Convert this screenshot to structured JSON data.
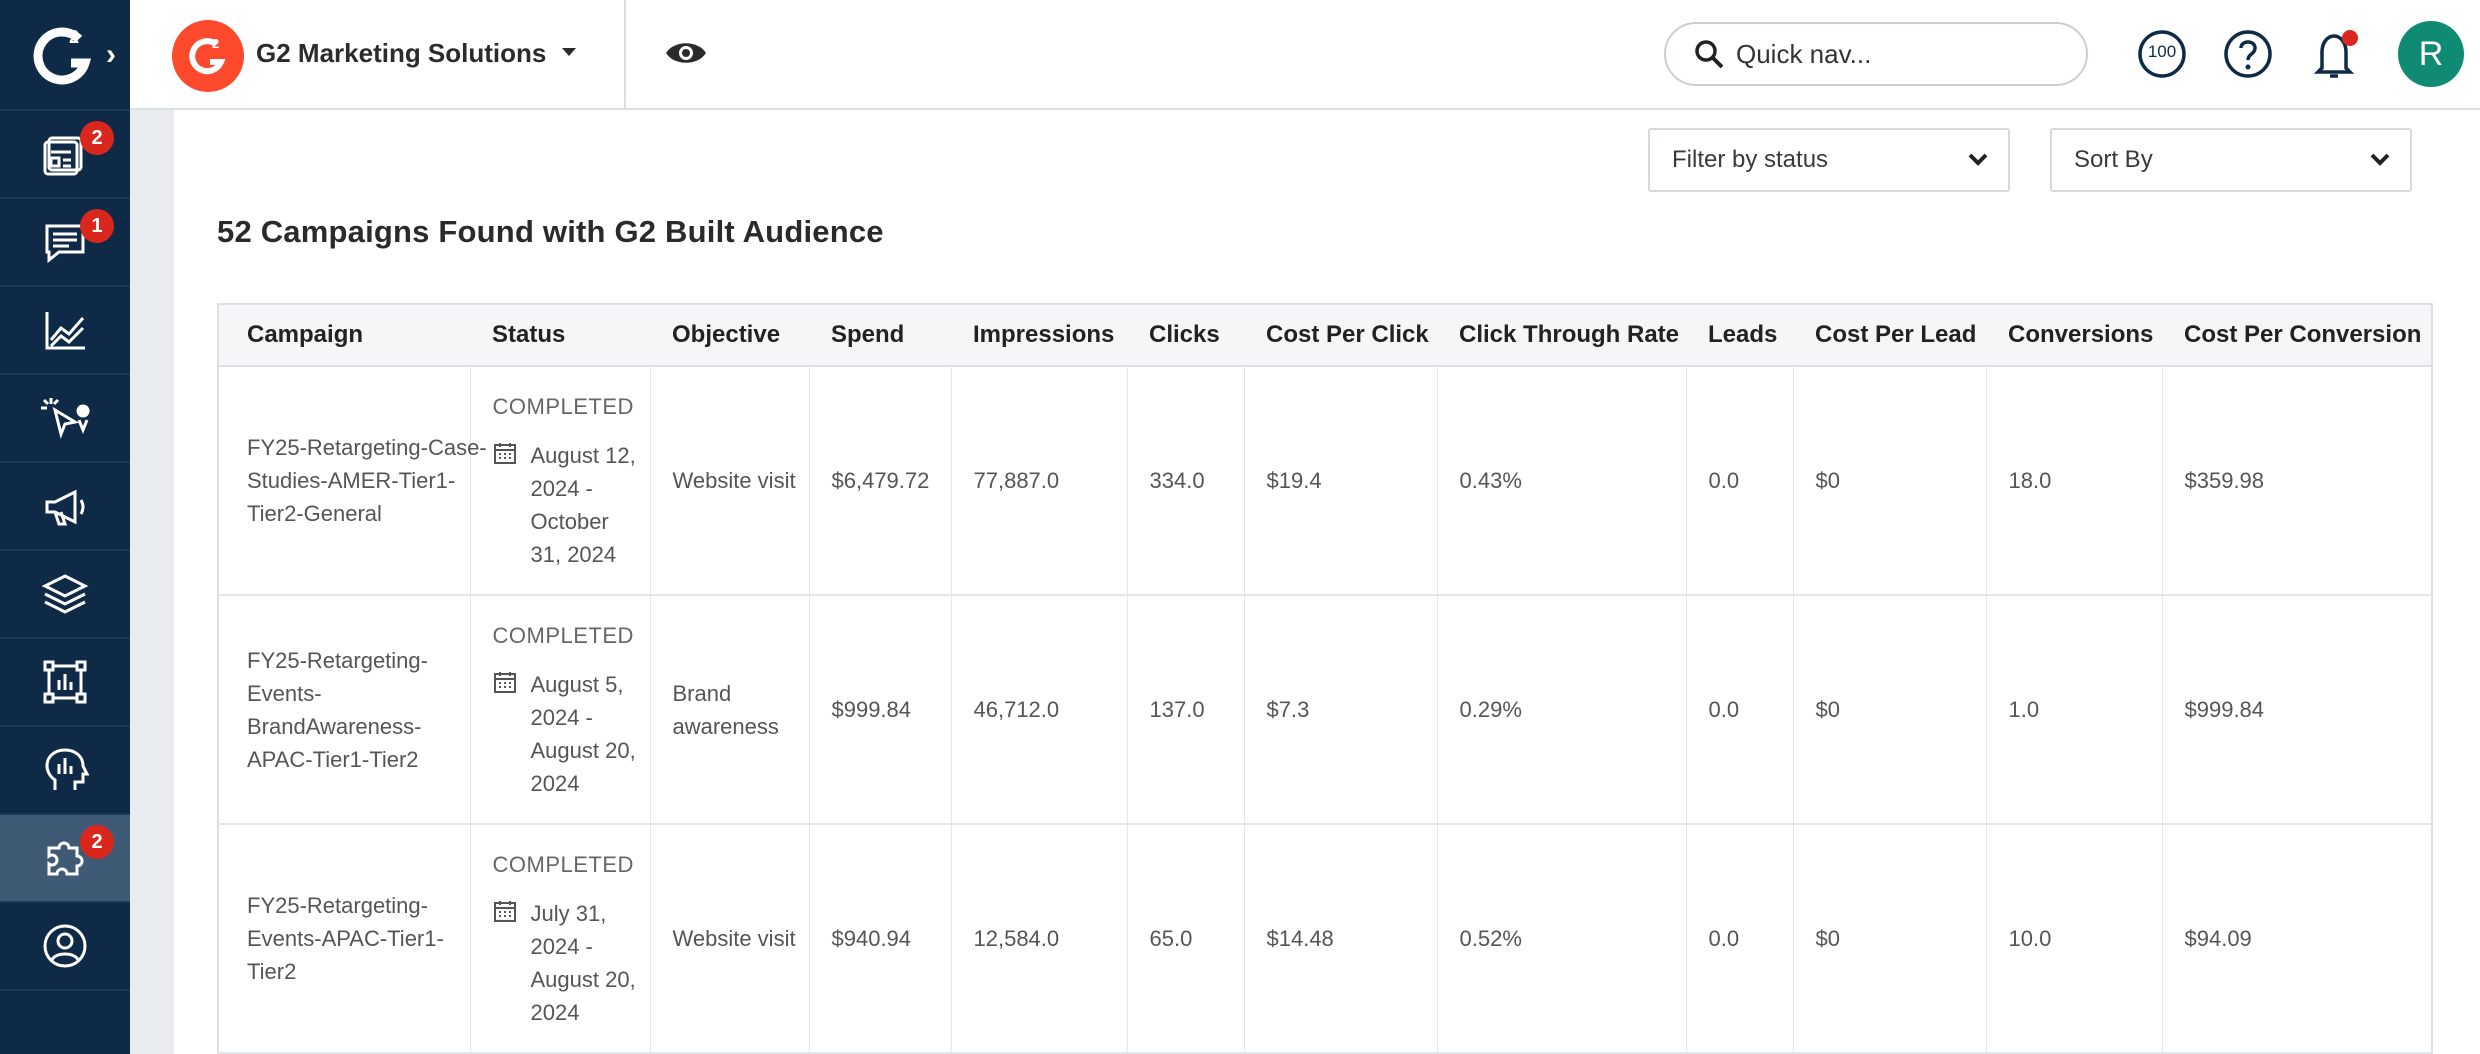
{
  "sidebar": {
    "badges": {
      "reports": "2",
      "messages": "1",
      "integrations": "2"
    }
  },
  "topbar": {
    "company_name": "G2 Marketing Solutions",
    "quick_nav_placeholder": "Quick nav...",
    "score_badge": "100",
    "avatar_initial": "R"
  },
  "filters": {
    "status_label": "Filter by status",
    "sort_label": "Sort By"
  },
  "heading": "52 Campaigns Found with G2 Built Audience",
  "table": {
    "columns": [
      "Campaign",
      "Status",
      "Objective",
      "Spend",
      "Impressions",
      "Clicks",
      "Cost Per Click",
      "Click Through Rate",
      "Leads",
      "Cost Per Lead",
      "Conversions",
      "Cost Per Conversion"
    ],
    "rows": [
      {
        "campaign": "FY25-Retargeting-Case-Studies-AMER-Tier1-Tier2-General",
        "status": "COMPLETED",
        "dates": "August 12, 2024 - October 31, 2024",
        "objective": "Website visit",
        "spend": "$6,479.72",
        "impressions": "77,887.0",
        "clicks": "334.0",
        "cpc": "$19.4",
        "ctr": "0.43%",
        "leads": "0.0",
        "cpl": "$0",
        "conversions": "18.0",
        "cost_per_conversion": "$359.98"
      },
      {
        "campaign": "FY25-Retargeting-Events-BrandAwareness-APAC-Tier1-Tier2",
        "status": "COMPLETED",
        "dates": "August 5, 2024 - August 20, 2024",
        "objective": "Brand awareness",
        "spend": "$999.84",
        "impressions": "46,712.0",
        "clicks": "137.0",
        "cpc": "$7.3",
        "ctr": "0.29%",
        "leads": "0.0",
        "cpl": "$0",
        "conversions": "1.0",
        "cost_per_conversion": "$999.84"
      },
      {
        "campaign": "FY25-Retargeting-Events-APAC-Tier1-Tier2",
        "status": "COMPLETED",
        "dates": "July 31, 2024 - August 20, 2024",
        "objective": "Website visit",
        "spend": "$940.94",
        "impressions": "12,584.0",
        "clicks": "65.0",
        "cpc": "$14.48",
        "ctr": "0.52%",
        "leads": "0.0",
        "cpl": "$0",
        "conversions": "10.0",
        "cost_per_conversion": "$94.09"
      }
    ]
  }
}
